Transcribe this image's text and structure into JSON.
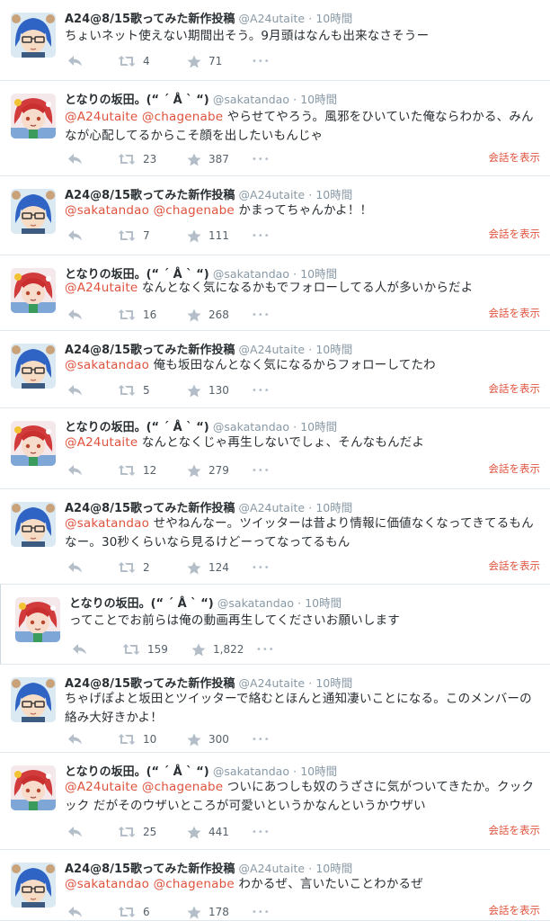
{
  "accounts": {
    "a24": {
      "name": "A24@8/15歌ってみた新作投稿",
      "handle": "@A24utaite",
      "avatar_icon": "blue-hair-avatar"
    },
    "saka": {
      "name": "となりの坂田。(“ ´ Å ` “)",
      "handle": "@sakatandao",
      "avatar_icon": "red-hair-avatar"
    }
  },
  "ui": {
    "dot": "·",
    "conversation_label": "会話を表示",
    "more_label": "•••"
  },
  "colors": {
    "mention": "#e0533e",
    "name": "#292f33",
    "meta": "#8899a6",
    "background": "#f5f8fa"
  },
  "tweets": [
    {
      "name": "A24@8/15歌ってみた新作投稿",
      "handle": "@A24utaite",
      "time": "10時間",
      "segments": [
        {
          "t": "ちょいネット使えない期間出そう。9月頭はなんも出来なさそうー",
          "m": false
        }
      ],
      "retweets": "4",
      "favorites": "71",
      "conversation": false,
      "avatar": "blue"
    },
    {
      "name": "となりの坂田。(“ ´ Å ` “)",
      "handle": "@sakatandao",
      "time": "10時間",
      "segments": [
        {
          "t": "@A24utaite",
          "m": true
        },
        {
          "t": " ",
          "m": false
        },
        {
          "t": "@chagenabe",
          "m": true
        },
        {
          "t": " やらせてやろう。風邪をひいていた俺ならわかる、みんなが心配してるからこそ顔を出したいもんじゃ",
          "m": false
        }
      ],
      "retweets": "23",
      "favorites": "387",
      "conversation": true,
      "avatar": "red"
    },
    {
      "name": "A24@8/15歌ってみた新作投稿",
      "handle": "@A24utaite",
      "time": "10時間",
      "segments": [
        {
          "t": "@sakatandao",
          "m": true
        },
        {
          "t": " ",
          "m": false
        },
        {
          "t": "@chagenabe",
          "m": true
        },
        {
          "t": " かまってちゃんかよ！！",
          "m": false
        }
      ],
      "retweets": "7",
      "favorites": "111",
      "conversation": true,
      "avatar": "blue"
    },
    {
      "name": "となりの坂田。(“ ´ Å ` “)",
      "handle": "@sakatandao",
      "time": "10時間",
      "segments": [
        {
          "t": "@A24utaite",
          "m": true
        },
        {
          "t": " なんとなく気になるかもでフォローしてる人が多いからだよ",
          "m": false
        }
      ],
      "retweets": "16",
      "favorites": "268",
      "conversation": true,
      "avatar": "red"
    },
    {
      "name": "A24@8/15歌ってみた新作投稿",
      "handle": "@A24utaite",
      "time": "10時間",
      "segments": [
        {
          "t": "@sakatandao",
          "m": true
        },
        {
          "t": " 俺も坂田なんとなく気になるからフォローしてたわ",
          "m": false
        }
      ],
      "retweets": "5",
      "favorites": "130",
      "conversation": true,
      "avatar": "blue"
    },
    {
      "name": "となりの坂田。(“ ´ Å ` “)",
      "handle": "@sakatandao",
      "time": "10時間",
      "segments": [
        {
          "t": "@A24utaite",
          "m": true
        },
        {
          "t": " なんとなくじゃ再生しないでしょ、そんなもんだよ",
          "m": false
        }
      ],
      "retweets": "12",
      "favorites": "279",
      "conversation": true,
      "avatar": "red"
    },
    {
      "name": "A24@8/15歌ってみた新作投稿",
      "handle": "@A24utaite",
      "time": "10時間",
      "segments": [
        {
          "t": "@sakatandao",
          "m": true
        },
        {
          "t": " せやねんなー。ツイッターは昔より情報に価値なくなってきてるもんなー。30秒くらいなら見るけどーってなってるもん",
          "m": false
        }
      ],
      "retweets": "2",
      "favorites": "124",
      "conversation": true,
      "avatar": "blue"
    },
    {
      "name": "となりの坂田。(“ ´ Å ` “)",
      "handle": "@sakatandao",
      "time": "10時間",
      "segments": [
        {
          "t": "ってことでお前らは俺の動画再生してくださいお願いします",
          "m": false
        }
      ],
      "retweets": "159",
      "favorites": "1,822",
      "conversation": false,
      "avatar": "red"
    },
    {
      "name": "A24@8/15歌ってみた新作投稿",
      "handle": "@A24utaite",
      "time": "10時間",
      "segments": [
        {
          "t": "ちゃげぽよと坂田とツイッターで絡むとほんと通知凄いことになる。このメンバーの絡み大好きかよ！",
          "m": false
        }
      ],
      "retweets": "10",
      "favorites": "300",
      "conversation": false,
      "avatar": "blue"
    },
    {
      "name": "となりの坂田。(“ ´ Å ` “)",
      "handle": "@sakatandao",
      "time": "10時間",
      "segments": [
        {
          "t": "@A24utaite",
          "m": true
        },
        {
          "t": " ",
          "m": false
        },
        {
          "t": "@chagenabe",
          "m": true
        },
        {
          "t": " ついにあつしも奴のうざさに気がついてきたか。クックック だがそのウザいところが可愛いというかなんというかウザい",
          "m": false
        }
      ],
      "retweets": "25",
      "favorites": "441",
      "conversation": true,
      "avatar": "red"
    },
    {
      "name": "A24@8/15歌ってみた新作投稿",
      "handle": "@A24utaite",
      "time": "10時間",
      "segments": [
        {
          "t": "@sakatandao",
          "m": true
        },
        {
          "t": " ",
          "m": false
        },
        {
          "t": "@chagenabe",
          "m": true
        },
        {
          "t": " わかるぜ、言いたいことわかるぜ",
          "m": false
        }
      ],
      "retweets": "6",
      "favorites": "178",
      "conversation": true,
      "avatar": "blue"
    }
  ]
}
